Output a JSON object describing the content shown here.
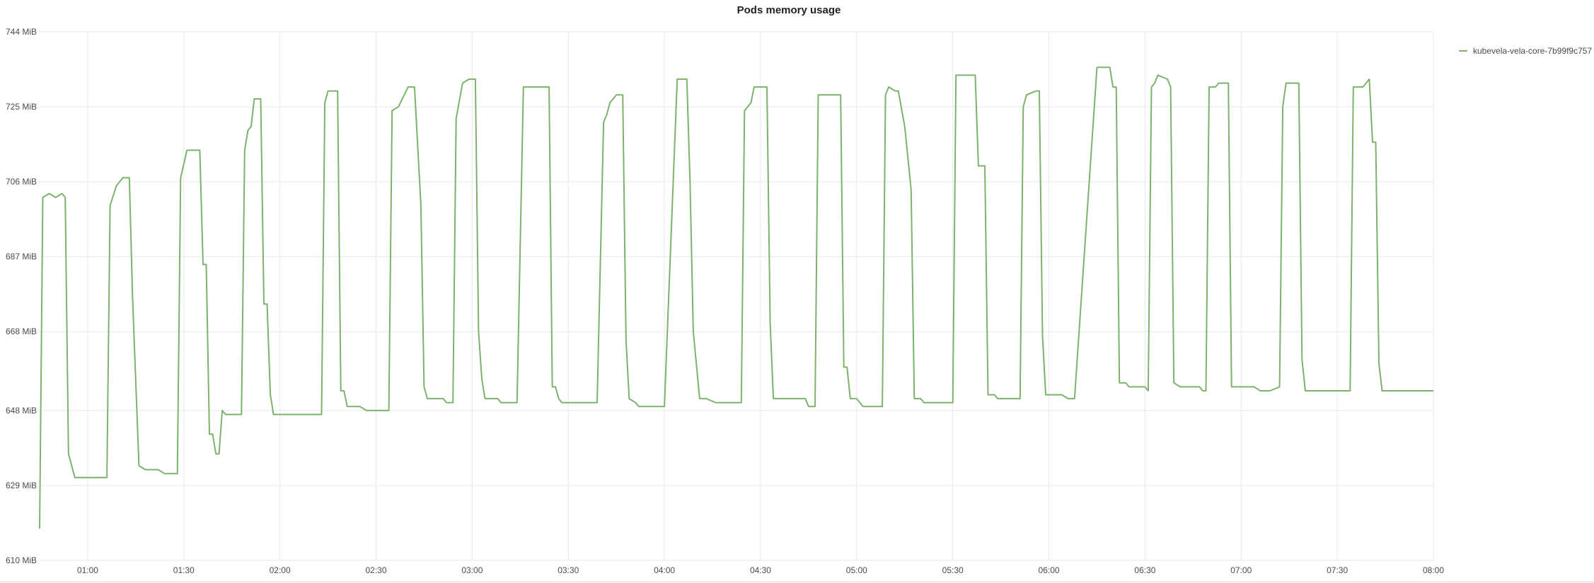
{
  "panel": {
    "title": "Pods memory usage"
  },
  "chart_data": {
    "type": "line",
    "title": "Pods memory usage",
    "xlabel": "",
    "ylabel": "",
    "grid": true,
    "legend_position": "top-right",
    "x_ticks": [
      "01:00",
      "01:30",
      "02:00",
      "02:30",
      "03:00",
      "03:30",
      "04:00",
      "04:30",
      "05:00",
      "05:30",
      "06:00",
      "06:30",
      "07:00",
      "07:30",
      "08:00"
    ],
    "y_ticks": [
      "610 MiB",
      "629 MiB",
      "648 MiB",
      "668 MiB",
      "687 MiB",
      "706 MiB",
      "725 MiB",
      "744 MiB"
    ],
    "y_tick_values": [
      610,
      629,
      648,
      668,
      687,
      706,
      725,
      744
    ],
    "x_tick_times": [
      "01:00",
      "01:30",
      "02:00",
      "02:30",
      "03:00",
      "03:30",
      "04:00",
      "04:30",
      "05:00",
      "05:30",
      "06:00",
      "06:30",
      "07:00",
      "07:30",
      "08:00"
    ],
    "xlim": [
      "00:45",
      "08:00"
    ],
    "ylim": [
      610,
      744
    ],
    "y_unit": "MiB",
    "series": [
      {
        "name": "kubevela-vela-core-7b99f9c757",
        "color": "#7eb26d",
        "points": [
          [
            "00:45",
            618
          ],
          [
            "00:46",
            702
          ],
          [
            "00:48",
            703
          ],
          [
            "00:50",
            702
          ],
          [
            "00:52",
            703
          ],
          [
            "00:53",
            702
          ],
          [
            "00:54",
            637
          ],
          [
            "00:56",
            631
          ],
          [
            "01:00",
            631
          ],
          [
            "01:06",
            631
          ],
          [
            "01:07",
            700
          ],
          [
            "01:09",
            705
          ],
          [
            "01:11",
            707
          ],
          [
            "01:13",
            707
          ],
          [
            "01:14",
            677
          ],
          [
            "01:16",
            634
          ],
          [
            "01:18",
            633
          ],
          [
            "01:22",
            633
          ],
          [
            "01:24",
            632
          ],
          [
            "01:28",
            632
          ],
          [
            "01:29",
            707
          ],
          [
            "01:31",
            714
          ],
          [
            "01:35",
            714
          ],
          [
            "01:36",
            685
          ],
          [
            "01:37",
            685
          ],
          [
            "01:38",
            642
          ],
          [
            "01:39",
            642
          ],
          [
            "01:40",
            637
          ],
          [
            "01:41",
            637
          ],
          [
            "01:42",
            648
          ],
          [
            "01:43",
            647
          ],
          [
            "01:48",
            647
          ],
          [
            "01:49",
            714
          ],
          [
            "01:50",
            719
          ],
          [
            "01:51",
            720
          ],
          [
            "01:52",
            727
          ],
          [
            "01:54",
            727
          ],
          [
            "01:55",
            675
          ],
          [
            "01:56",
            675
          ],
          [
            "01:57",
            652
          ],
          [
            "01:58",
            647
          ],
          [
            "02:03",
            647
          ],
          [
            "02:13",
            647
          ],
          [
            "02:14",
            726
          ],
          [
            "02:15",
            729
          ],
          [
            "02:18",
            729
          ],
          [
            "02:19",
            653
          ],
          [
            "02:20",
            653
          ],
          [
            "02:21",
            649
          ],
          [
            "02:25",
            649
          ],
          [
            "02:27",
            648
          ],
          [
            "02:34",
            648
          ],
          [
            "02:35",
            724
          ],
          [
            "02:37",
            725
          ],
          [
            "02:40",
            730
          ],
          [
            "02:42",
            730
          ],
          [
            "02:44",
            700
          ],
          [
            "02:45",
            654
          ],
          [
            "02:46",
            651
          ],
          [
            "02:51",
            651
          ],
          [
            "02:52",
            650
          ],
          [
            "02:54",
            650
          ],
          [
            "02:55",
            722
          ],
          [
            "02:57",
            731
          ],
          [
            "02:59",
            732
          ],
          [
            "03:01",
            732
          ],
          [
            "03:02",
            668
          ],
          [
            "03:03",
            656
          ],
          [
            "03:04",
            651
          ],
          [
            "03:08",
            651
          ],
          [
            "03:09",
            650
          ],
          [
            "03:14",
            650
          ],
          [
            "03:16",
            730
          ],
          [
            "03:24",
            730
          ],
          [
            "03:25",
            654
          ],
          [
            "03:26",
            654
          ],
          [
            "03:27",
            651
          ],
          [
            "03:28",
            650
          ],
          [
            "03:30",
            650
          ],
          [
            "03:39",
            650
          ],
          [
            "03:41",
            721
          ],
          [
            "03:42",
            723
          ],
          [
            "03:43",
            726
          ],
          [
            "03:45",
            728
          ],
          [
            "03:47",
            728
          ],
          [
            "03:48",
            666
          ],
          [
            "03:49",
            651
          ],
          [
            "03:51",
            650
          ],
          [
            "03:52",
            649
          ],
          [
            "03:55",
            649
          ],
          [
            "04:00",
            649
          ],
          [
            "04:04",
            732
          ],
          [
            "04:07",
            732
          ],
          [
            "04:08",
            706
          ],
          [
            "04:09",
            668
          ],
          [
            "04:11",
            651
          ],
          [
            "04:13",
            651
          ],
          [
            "04:16",
            650
          ],
          [
            "04:24",
            650
          ],
          [
            "04:25",
            724
          ],
          [
            "04:27",
            726
          ],
          [
            "04:28",
            730
          ],
          [
            "04:32",
            730
          ],
          [
            "04:33",
            670
          ],
          [
            "04:34",
            651
          ],
          [
            "04:36",
            651
          ],
          [
            "04:37",
            651
          ],
          [
            "04:44",
            651
          ],
          [
            "04:45",
            649
          ],
          [
            "04:47",
            649
          ],
          [
            "04:48",
            728
          ],
          [
            "04:55",
            728
          ],
          [
            "04:56",
            659
          ],
          [
            "04:57",
            659
          ],
          [
            "04:58",
            651
          ],
          [
            "05:00",
            651
          ],
          [
            "05:02",
            649
          ],
          [
            "05:05",
            649
          ],
          [
            "05:08",
            649
          ],
          [
            "05:09",
            728
          ],
          [
            "05:10",
            730
          ],
          [
            "05:12",
            729
          ],
          [
            "05:13",
            729
          ],
          [
            "05:15",
            720
          ],
          [
            "05:17",
            704
          ],
          [
            "05:18",
            651
          ],
          [
            "05:20",
            651
          ],
          [
            "05:21",
            650
          ],
          [
            "05:28",
            650
          ],
          [
            "05:30",
            650
          ],
          [
            "05:31",
            733
          ],
          [
            "05:34",
            733
          ],
          [
            "05:37",
            733
          ],
          [
            "05:38",
            710
          ],
          [
            "05:40",
            710
          ],
          [
            "05:41",
            652
          ],
          [
            "05:43",
            652
          ],
          [
            "05:44",
            651
          ],
          [
            "05:51",
            651
          ],
          [
            "05:52",
            725
          ],
          [
            "05:53",
            728
          ],
          [
            "05:56",
            729
          ],
          [
            "05:57",
            729
          ],
          [
            "05:58",
            667
          ],
          [
            "05:59",
            652
          ],
          [
            "06:04",
            652
          ],
          [
            "06:06",
            651
          ],
          [
            "06:08",
            651
          ],
          [
            "06:15",
            735
          ],
          [
            "06:19",
            735
          ],
          [
            "06:20",
            730
          ],
          [
            "06:21",
            730
          ],
          [
            "06:22",
            655
          ],
          [
            "06:24",
            655
          ],
          [
            "06:25",
            654
          ],
          [
            "06:30",
            654
          ],
          [
            "06:31",
            653
          ],
          [
            "06:32",
            730
          ],
          [
            "06:33",
            731
          ],
          [
            "06:34",
            733
          ],
          [
            "06:37",
            732
          ],
          [
            "06:38",
            730
          ],
          [
            "06:39",
            655
          ],
          [
            "06:41",
            654
          ],
          [
            "06:42",
            654
          ],
          [
            "06:47",
            654
          ],
          [
            "06:48",
            653
          ],
          [
            "06:49",
            653
          ],
          [
            "06:50",
            730
          ],
          [
            "06:52",
            730
          ],
          [
            "06:53",
            731
          ],
          [
            "06:56",
            731
          ],
          [
            "06:57",
            654
          ],
          [
            "06:59",
            654
          ],
          [
            "07:01",
            654
          ],
          [
            "07:04",
            654
          ],
          [
            "07:06",
            653
          ],
          [
            "07:09",
            653
          ],
          [
            "07:12",
            654
          ],
          [
            "07:13",
            725
          ],
          [
            "07:14",
            731
          ],
          [
            "07:18",
            731
          ],
          [
            "07:19",
            661
          ],
          [
            "07:20",
            653
          ],
          [
            "07:22",
            653
          ],
          [
            "07:30",
            653
          ],
          [
            "07:34",
            653
          ],
          [
            "07:35",
            730
          ],
          [
            "07:36",
            730
          ],
          [
            "07:38",
            730
          ],
          [
            "07:39",
            731
          ],
          [
            "07:40",
            732
          ],
          [
            "07:41",
            716
          ],
          [
            "07:42",
            716
          ],
          [
            "07:43",
            660
          ],
          [
            "07:44",
            653
          ],
          [
            "07:48",
            653
          ],
          [
            "07:50",
            653
          ],
          [
            "08:00",
            653
          ]
        ]
      }
    ]
  }
}
